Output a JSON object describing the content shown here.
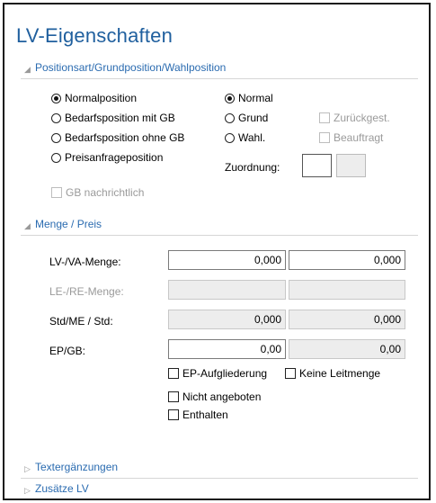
{
  "title": "LV-Eigenschaften",
  "sections": {
    "positionsart": "Positionsart/Grundposition/Wahlposition",
    "menge_preis": "Menge / Preis",
    "textergaenzungen": "Textergänzungen",
    "zusaetze": "Zusätze LV"
  },
  "positionsart": {
    "left_radios": [
      {
        "label": "Normalposition",
        "selected": true
      },
      {
        "label": "Bedarfsposition mit GB",
        "selected": false
      },
      {
        "label": "Bedarfsposition ohne GB",
        "selected": false
      },
      {
        "label": "Preisanfrageposition",
        "selected": false
      }
    ],
    "right_radios": [
      {
        "label": "Normal",
        "selected": true
      },
      {
        "label": "Grund",
        "selected": false
      },
      {
        "label": "Wahl.",
        "selected": false
      }
    ],
    "zurueckgest_label": "Zurückgest.",
    "beauftragt_label": "Beauftragt",
    "zuordnung_label": "Zuordnung:",
    "gb_nachrichtlich_label": "GB nachrichtlich"
  },
  "menge": {
    "lv_va_menge": {
      "label": "LV-/VA-Menge:",
      "value1": "0,000",
      "value2": "0,000"
    },
    "le_re_menge": {
      "label": "LE-/RE-Menge:",
      "value1": "",
      "value2": ""
    },
    "std_me": {
      "label": "Std/ME / Std:",
      "value1": "0,000",
      "value2": "0,000"
    },
    "ep_gb": {
      "label": "EP/GB:",
      "value1": "0,00",
      "value2": "0,00"
    },
    "ep_aufgliederung_label": "EP-Aufgliederung",
    "keine_leitmenge_label": "Keine Leitmenge",
    "nicht_angeboten_label": "Nicht angeboten",
    "enthalten_label": "Enthalten"
  }
}
